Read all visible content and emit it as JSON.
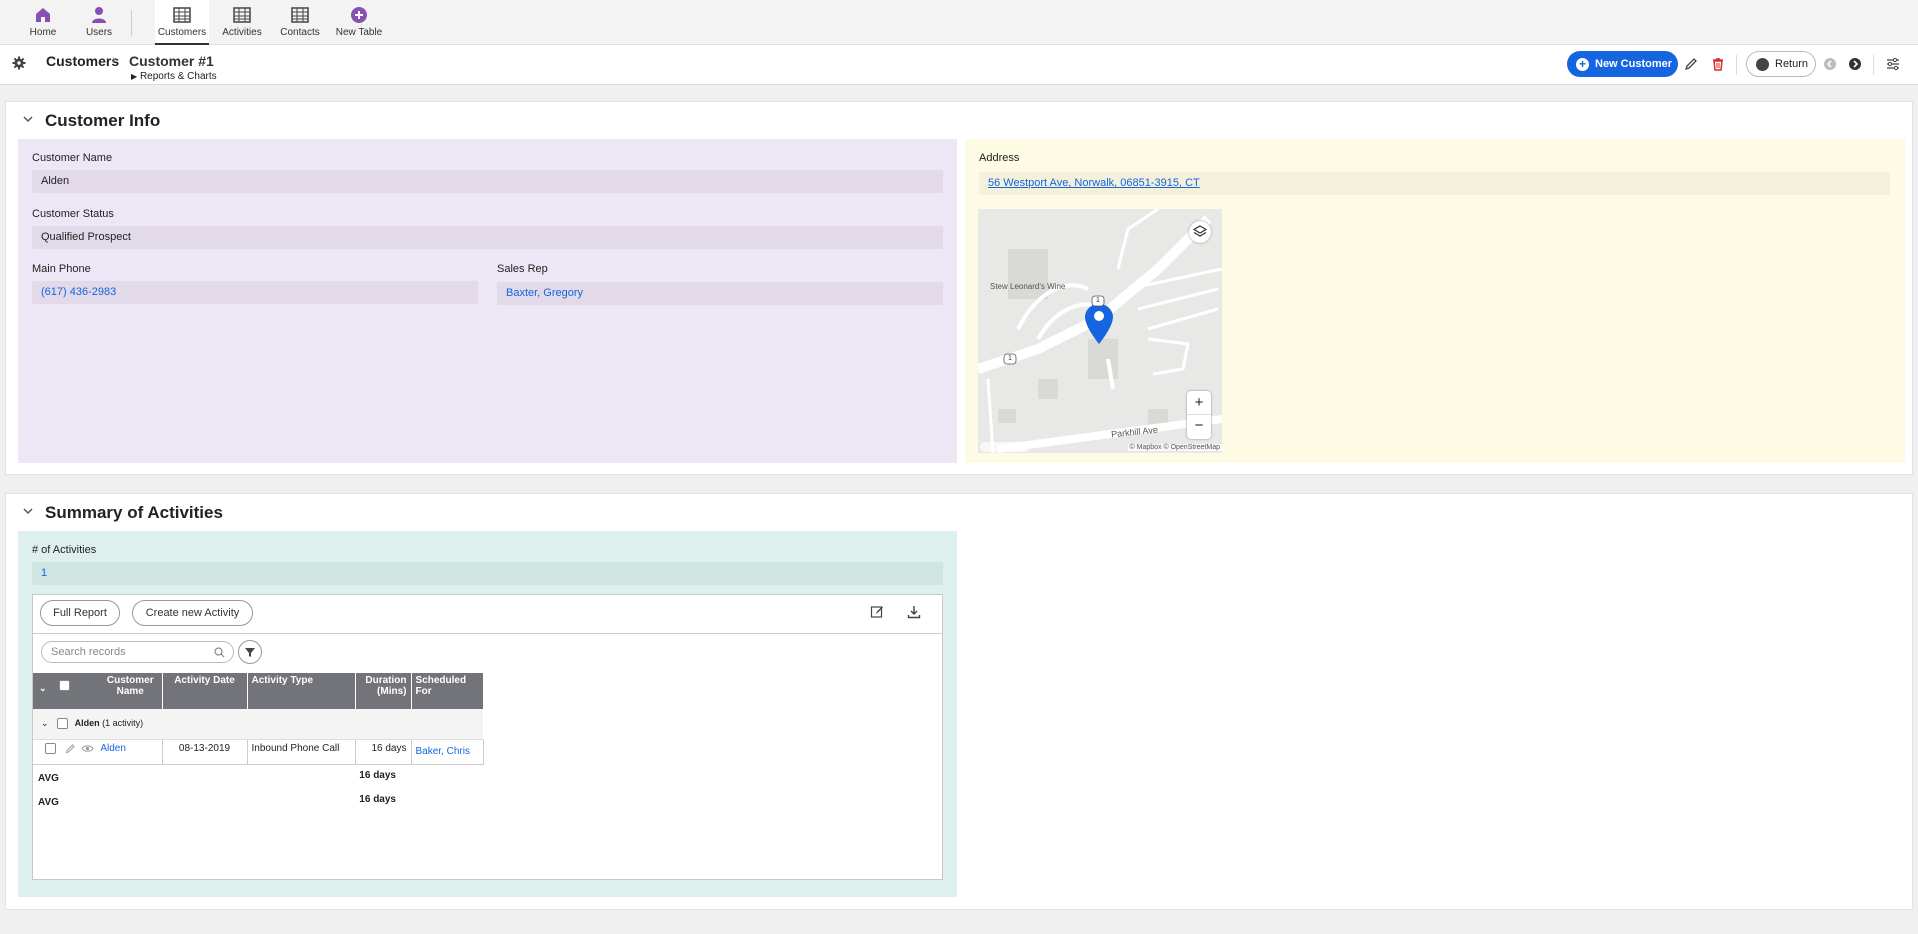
{
  "nav": {
    "items": [
      {
        "label": "Home",
        "icon": "home-icon"
      },
      {
        "label": "Users",
        "icon": "user-icon"
      },
      {
        "label": "Customers",
        "icon": "table-icon"
      },
      {
        "label": "Activities",
        "icon": "table-icon"
      },
      {
        "label": "Contacts",
        "icon": "table-icon"
      },
      {
        "label": "New Table",
        "icon": "plus-circle-icon"
      }
    ],
    "active": "Customers",
    "accent": "#8a4fb3"
  },
  "header": {
    "breadcrumb_root": "Customers",
    "breadcrumb_sep": "›",
    "breadcrumb_current": "Customer #1",
    "reports_link": "Reports & Charts",
    "new_button": "New Customer",
    "return_button": "Return",
    "primary_color": "#1565e0"
  },
  "customer_info": {
    "title": "Customer Info",
    "name_label": "Customer Name",
    "name_value": "Alden",
    "status_label": "Customer Status",
    "status_value": "Qualified Prospect",
    "phone_label": "Main Phone",
    "phone_value": "(617) 436-2983",
    "rep_label": "Sales Rep",
    "rep_value": "Baxter, Gregory",
    "address_label": "Address",
    "address_value": "56 Westport Ave, Norwalk, 06851-3915, CT",
    "map": {
      "place_label": "Stew Leonard's Wine",
      "street_label": "Parkhill Ave",
      "route_shield": "1",
      "attribution": "© Mapbox © OpenStreetMap",
      "zoom_in": "+",
      "zoom_out": "−"
    }
  },
  "summary": {
    "title": "Summary of Activities",
    "count_label": "# of Activities",
    "count_value": "1",
    "full_report_button": "Full Report",
    "create_button": "Create new Activity",
    "search_placeholder": "Search records",
    "columns": [
      "Customer Name",
      "Activity Date",
      "Activity Type",
      "Duration (Mins)",
      "Scheduled For"
    ],
    "group_label": "Alden",
    "group_count": "(1 activity)",
    "rows": [
      {
        "customer": "Alden",
        "date": "08-13-2019",
        "type": "Inbound Phone Call",
        "duration": "16 days",
        "scheduled": "Baker, Chris"
      }
    ],
    "avg_label": "AVG",
    "avg_values": [
      "16 days",
      "16 days"
    ]
  }
}
